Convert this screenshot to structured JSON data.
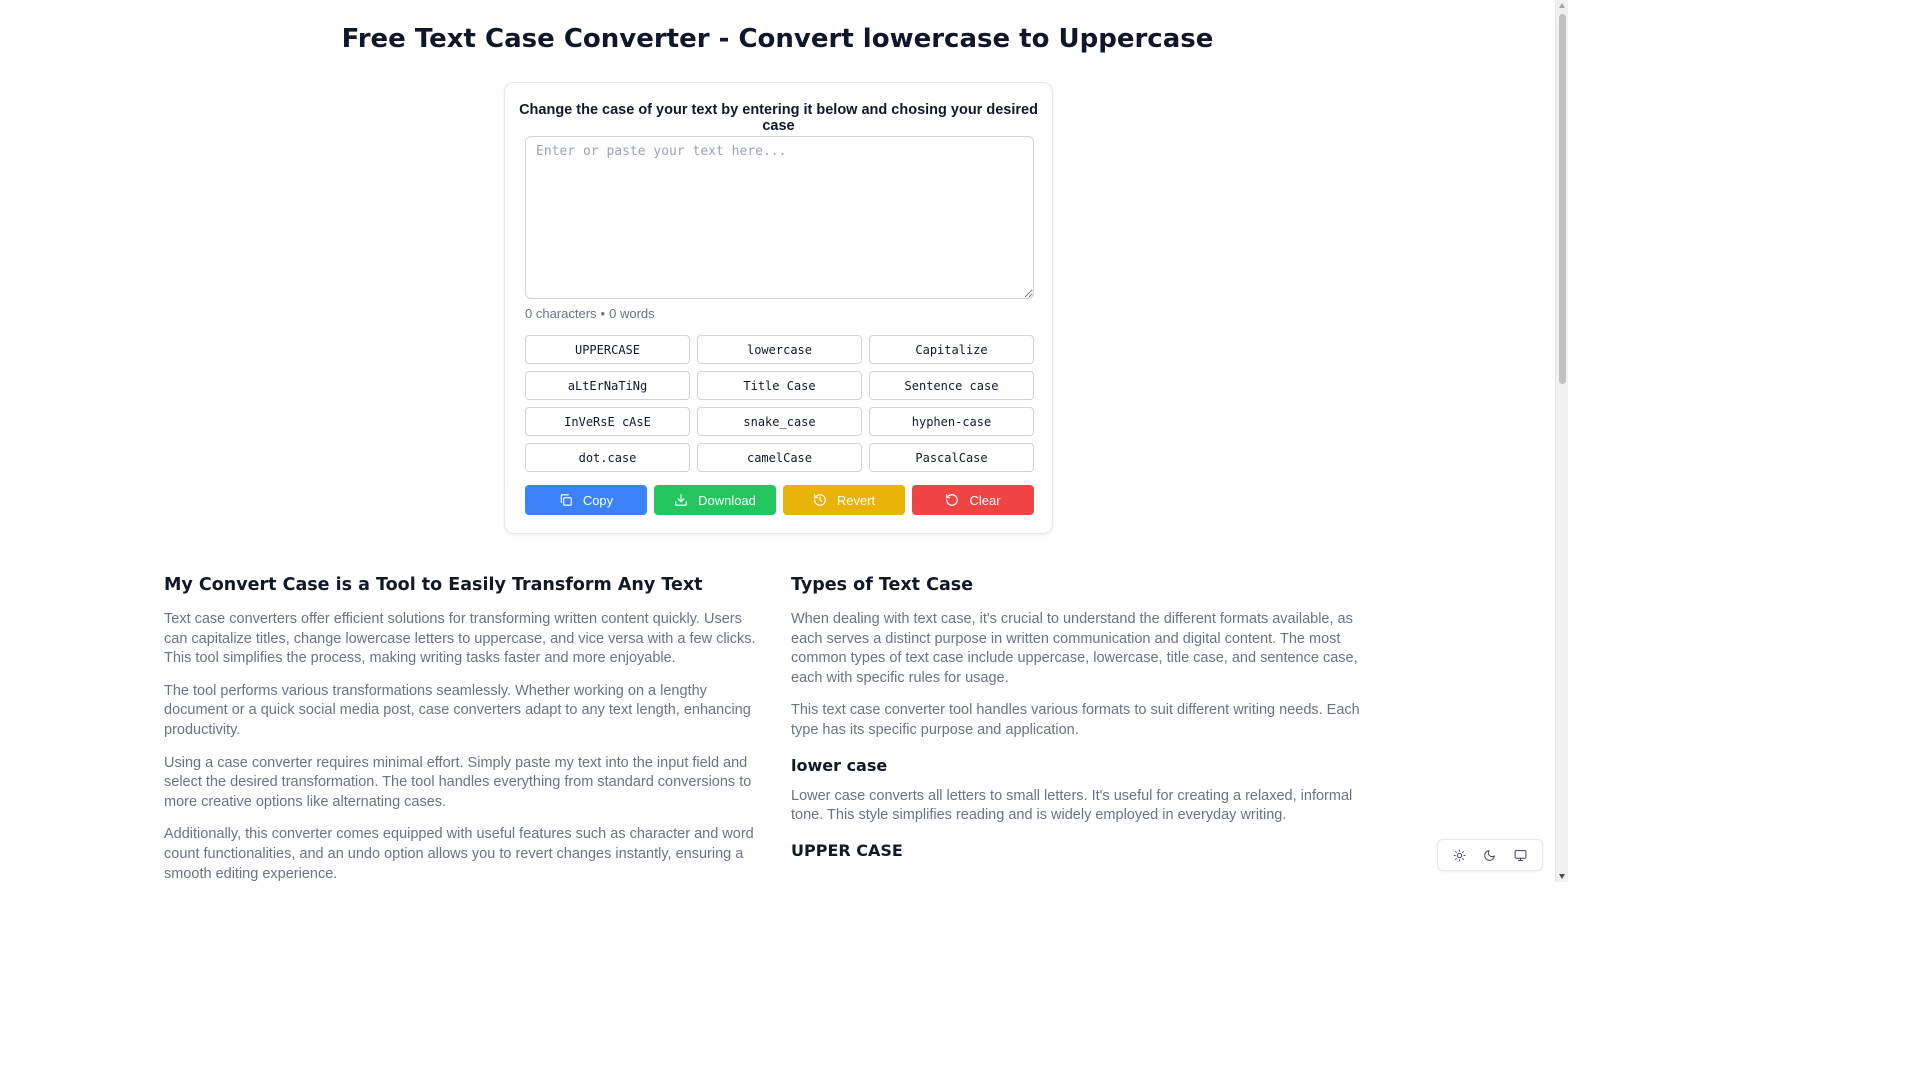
{
  "page": {
    "title": "Free Text Case Converter - Convert lowercase to Uppercase"
  },
  "converter": {
    "subtitle": "Change the case of your text by entering it below and chosing your desired case",
    "input_placeholder": "Enter or paste your text here...",
    "input_value": "",
    "char_count": "0 characters",
    "separator": "•",
    "word_count": "0 words",
    "case_buttons": [
      {
        "label": "UPPERCASE"
      },
      {
        "label": "lowercase"
      },
      {
        "label": "Capitalize"
      },
      {
        "label": "aLtErNaTiNg"
      },
      {
        "label": "Title Case"
      },
      {
        "label": "Sentence case"
      },
      {
        "label": "InVeRsE cAsE"
      },
      {
        "label": "snake_case"
      },
      {
        "label": "hyphen-case"
      },
      {
        "label": "dot.case"
      },
      {
        "label": "camelCase"
      },
      {
        "label": "PascalCase"
      }
    ],
    "actions": {
      "copy": {
        "label": "Copy",
        "icon": "copy-icon",
        "color": "#3b82f6"
      },
      "download": {
        "label": "Download",
        "icon": "download-icon",
        "color": "#22c55e"
      },
      "revert": {
        "label": "Revert",
        "icon": "history-icon",
        "color": "#eab308"
      },
      "clear": {
        "label": "Clear",
        "icon": "rotate-ccw-icon",
        "color": "#ef4444"
      }
    }
  },
  "left_section": {
    "heading": "My Convert Case is a Tool to Easily Transform Any Text",
    "paragraphs": [
      "Text case converters offer efficient solutions for transforming written content quickly. Users can capitalize titles, change lowercase letters to uppercase, and vice versa with a few clicks. This tool simplifies the process, making writing tasks faster and more enjoyable.",
      "The tool performs various transformations seamlessly. Whether working on a lengthy document or a quick social media post, case converters adapt to any text length, enhancing productivity.",
      "Using a case converter requires minimal effort. Simply paste my text into the input field and select the desired transformation. The tool handles everything from standard conversions to more creative options like alternating cases.",
      "Additionally, this converter comes equipped with useful features such as character and word count functionalities, and an undo option allows you to revert changes instantly, ensuring a smooth editing experience."
    ]
  },
  "right_section": {
    "heading": "Types of Text Case",
    "paragraphs": [
      "When dealing with text case, it's crucial to understand the different formats available, as each serves a distinct purpose in written communication and digital content. The most common types of text case include uppercase, lowercase, title case, and sentence case, each with specific rules for usage.",
      "This text case converter tool handles various formats to suit different writing needs. Each type has its specific purpose and application."
    ],
    "lower_heading": "lower case",
    "lower_paragraph": "Lower case converts all letters to small letters. It's useful for creating a relaxed, informal tone. This style simplifies reading and is widely employed in everyday writing.",
    "upper_heading": "UPPER CASE"
  },
  "theme_switcher": {
    "icons": [
      "sun-icon",
      "moon-icon",
      "monitor-icon"
    ]
  }
}
